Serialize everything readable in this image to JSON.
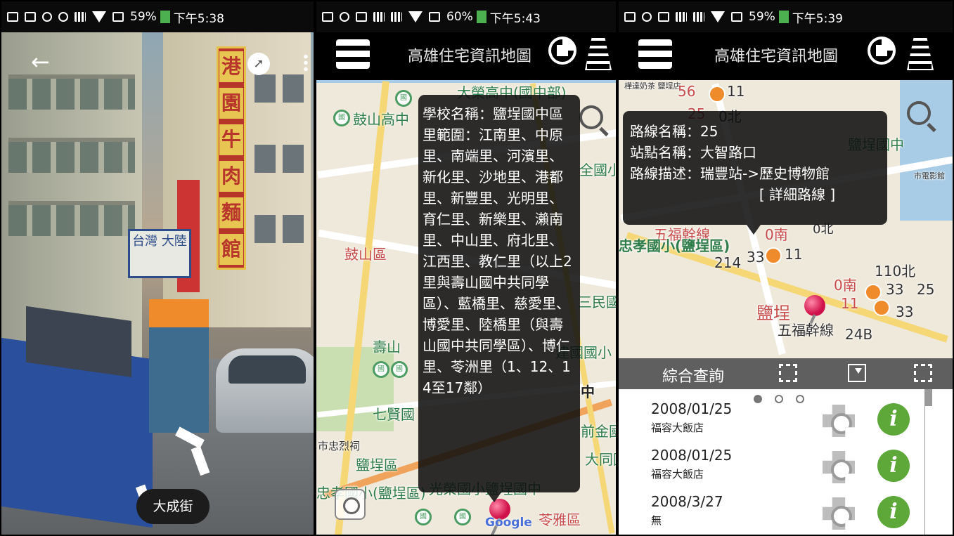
{
  "panel1": {
    "status": {
      "battery": "59%",
      "time": "下午5:38"
    },
    "street_label": "大成街",
    "signs": [
      "港",
      "園",
      "牛",
      "肉",
      "麵",
      "館"
    ],
    "store_sign": "台灣 大陸"
  },
  "panel2": {
    "status": {
      "battery": "60%",
      "time": "下午5:43"
    },
    "app_title": "高雄住宅資訊地圖",
    "map_labels": {
      "gushan_high": "鼓山高中",
      "rongzhong": "大榮高中(國中部)",
      "gushan_district": "鼓山區",
      "qixian": "七賢國",
      "shoushan": "壽山",
      "yancheng": "鹽埕區",
      "zhongxiao": "忠孝國小(鹽埕區)",
      "shizhongci": "市忠烈祠",
      "yanchengguozhong": "光榮國小鹽埕國中",
      "minsheng": "三民國小",
      "jianguo": "建國國小",
      "qianjin": "前金國小",
      "datong": "大同國小",
      "quanguo": "全國小",
      "lingya": "苓雅區",
      "zhongxiaoA": "中",
      "google": "Google"
    },
    "tooltip": {
      "text": "學校名稱：鹽埕國中區里範圍：江南里、中原里、南端里、河濱里、新化里、沙地里、港都里、新豐里、光明里、育仁里、新樂里、瀨南里、中山里、府北里、江西里、教仁里（以上2里與壽山國中共同學區）、藍橋里、慈愛里、博愛里、陸橋里（與壽山國中共同學區）、博仁里、苓洲里（1、12、14至17鄰）"
    }
  },
  "panel3": {
    "status": {
      "battery": "59%",
      "time": "下午5:39"
    },
    "app_title": "高雄住宅資訊地圖",
    "map_labels": {
      "route56": "56",
      "route11a": "11",
      "route25": "25",
      "route0north": "0北",
      "yanchengguozhong": "鹽埕國中",
      "wufu": "五福幹線",
      "zhongxiao": "忠孝國小(鹽埕區)",
      "r214": "214",
      "r33a": "33",
      "r11b": "11",
      "r0south": "0南",
      "r0north2": "0北",
      "r110": "110北",
      "r0south2": "0南",
      "r33b": "33",
      "r25b": "25",
      "r11c": "11",
      "r33c": "33",
      "yancheng": "鹽埕",
      "wufu2": "五福幹線",
      "r24b": "24B",
      "cinema": "市電影館",
      "teashop": "樺達奶茶 鹽埕店"
    },
    "tooltip": {
      "route_name": "路線名稱：25",
      "stop_name": "站點名稱：大智路口",
      "route_desc": "路線描述：瑞豐站->歷史博物館",
      "detail_link": "[ 詳細路線 ]"
    },
    "query_bar": {
      "label": "綜合查詢"
    },
    "pager": {
      "pages": 3,
      "active": 0
    },
    "list": [
      {
        "date": "2008/01/25",
        "place": "福容大飯店"
      },
      {
        "date": "2008/01/25",
        "place": "福容大飯店"
      },
      {
        "date": "2008/3/27",
        "place": "無"
      }
    ],
    "colors": {
      "info_icon": "#5ea83a",
      "query_bar": "#5f5f5f"
    }
  }
}
